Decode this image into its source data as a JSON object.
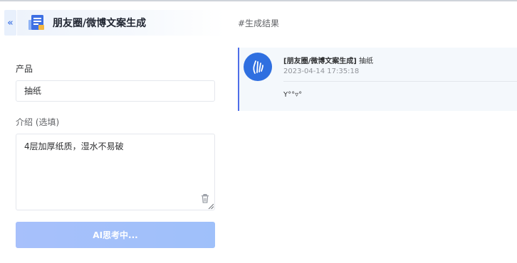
{
  "header": {
    "collapse_icon": "double-chevron-left-icon",
    "logo_icon": "document-stack-icon",
    "title": "朋友圈/微博文案生成",
    "accent_color": "#4e7fe6"
  },
  "form": {
    "product_label": "产品",
    "product_value": "抽纸",
    "intro_label": "介绍 (选填)",
    "intro_value": "4层加厚纸质，湿水不易破",
    "clear_icon": "trash-icon",
    "submit_label": "AI思考中...",
    "submit_color": "#a7c0fb"
  },
  "results": {
    "heading": "#生成结果",
    "items": [
      {
        "avatar_icon": "hand-gesture-icon",
        "category": "[朋友圈/微博文案生成]",
        "product": "抽纸",
        "timestamp": "2023-04-14 17:35:18",
        "content": "Y°°▿°"
      }
    ]
  }
}
